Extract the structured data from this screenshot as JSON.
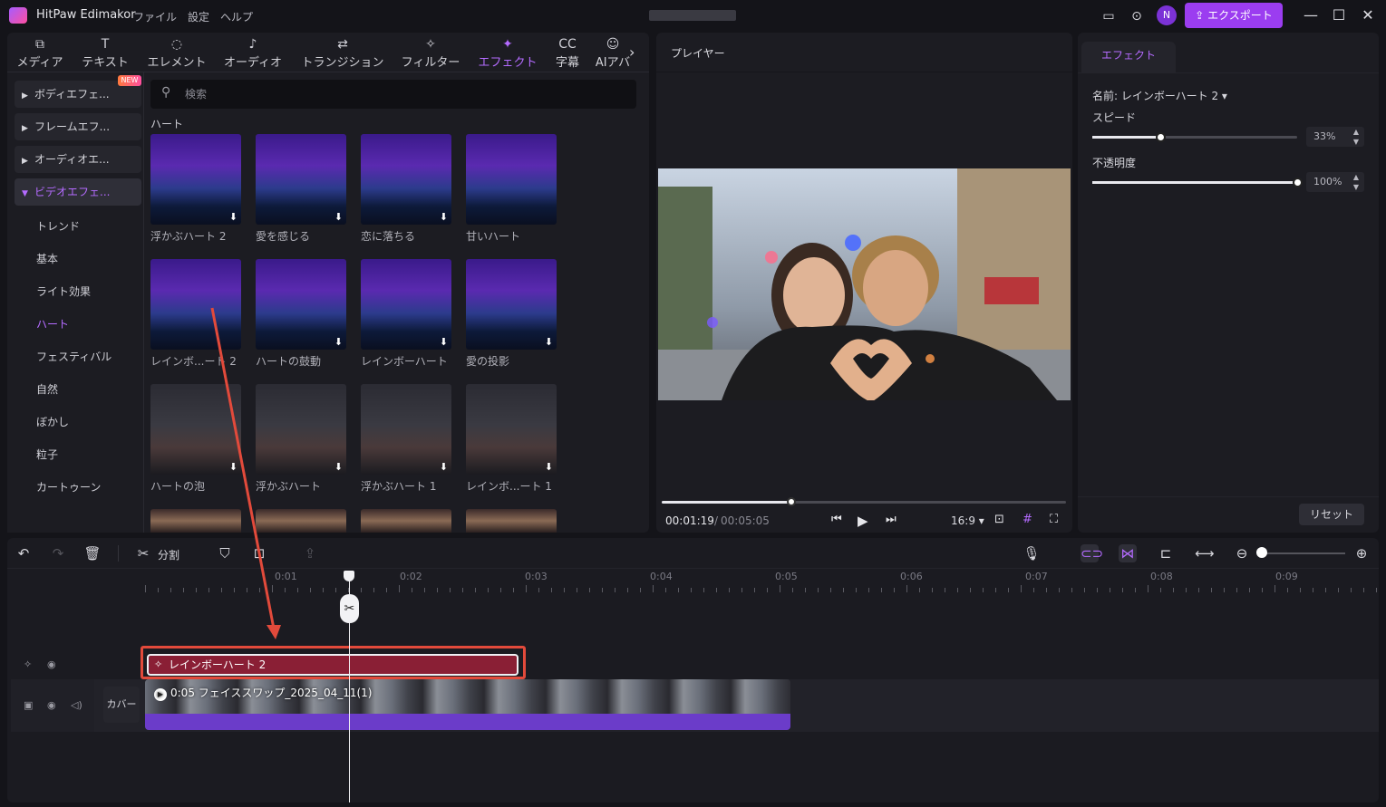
{
  "app": {
    "name": "HitPaw Edimakor",
    "menu": [
      "ファイル",
      "設定",
      "ヘルプ"
    ],
    "avatar_letter": "N",
    "export_label": "エクスポート"
  },
  "media": {
    "tabs": [
      {
        "label": "メディア",
        "icon": "media-icon"
      },
      {
        "label": "テキスト",
        "icon": "text-icon"
      },
      {
        "label": "エレメント",
        "icon": "element-icon"
      },
      {
        "label": "オーディオ",
        "icon": "audio-icon"
      },
      {
        "label": "トランジション",
        "icon": "transition-icon"
      },
      {
        "label": "フィルター",
        "icon": "filter-icon"
      },
      {
        "label": "エフェクト",
        "icon": "effect-icon"
      },
      {
        "label": "字幕",
        "icon": "subtitle-icon"
      },
      {
        "label": "AIアバ",
        "icon": "ai-avatar-icon"
      }
    ],
    "active_tab": "エフェクト",
    "categories": [
      {
        "label": "ボディエフェ...",
        "badge": "NEW"
      },
      {
        "label": "フレームエフ..."
      },
      {
        "label": "オーディオエ..."
      },
      {
        "label": "ビデオエフェ..."
      }
    ],
    "subcategories": [
      "トレンド",
      "基本",
      "ライト効果",
      "ハート",
      "フェスティバル",
      "自然",
      "ぼかし",
      "粒子",
      "カートゥーン"
    ],
    "active_subcategory": "ハート",
    "search_placeholder": "検索",
    "section_title": "ハート",
    "thumbnails": [
      [
        "浮かぶハート 2",
        "愛を感じる",
        "恋に落ちる",
        "甘いハート"
      ],
      [
        "レインボ...ート 2",
        "ハートの鼓動",
        "レインボーハート",
        "愛の投影"
      ],
      [
        "ハートの泡",
        "浮かぶハート",
        "浮かぶハート 1",
        "レインボ...ート 1"
      ]
    ]
  },
  "player": {
    "title": "プレイヤー",
    "current_time": "00:01:19",
    "separator": "/",
    "total_time": "00:05:05",
    "progress": 0.32,
    "aspect": "16:9"
  },
  "effect_panel": {
    "tab": "エフェクト",
    "name_label": "名前:",
    "name_value": "レインボーハート 2",
    "speed_label": "スピード",
    "speed_value": "33%",
    "speed_fraction": 0.33,
    "opacity_label": "不透明度",
    "opacity_value": "100%",
    "opacity_fraction": 1.0,
    "reset_label": "リセット"
  },
  "timeline": {
    "split_label": "分割",
    "ruler_labels": [
      "0:01",
      "0:02",
      "0:03",
      "0:04",
      "0:05",
      "0:06",
      "0:07",
      "0:08",
      "0:09"
    ],
    "effect_clip_label": "レインボーハート 2",
    "cover_label": "カバー",
    "video_clip_label": "0:05 フェイススワップ_2025_04_11(1)"
  },
  "colors": {
    "accent": "#b46bff",
    "export": "#9b3df0",
    "effect_clip": "#8a1f35",
    "audio": "#6b3cc9",
    "highlight": "#e24a3b"
  }
}
